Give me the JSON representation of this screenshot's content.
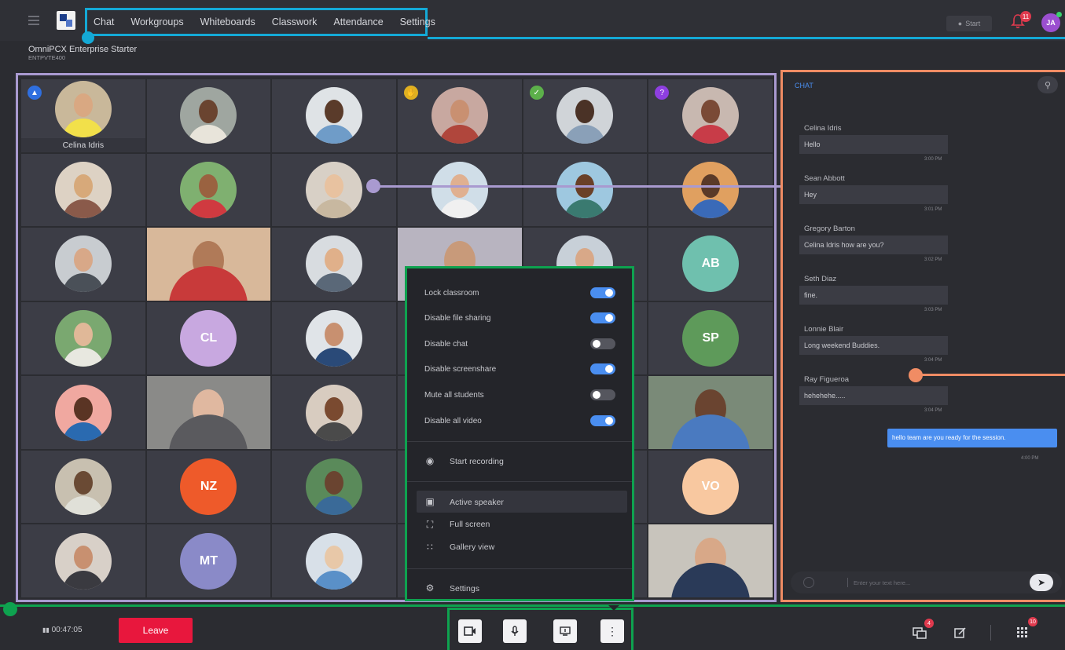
{
  "topbar": {
    "nav": [
      "Chat",
      "Workgroups",
      "Whiteboards",
      "Classwork",
      "Attendance",
      "Settings"
    ],
    "start_label": "Start",
    "notifications_count": "11",
    "user_initials": "JA"
  },
  "subheader": {
    "title": "OmniPCX Enterprise Starter",
    "code": "ENTPVTE400"
  },
  "gallery": {
    "first_participant_name": "Celina Idris",
    "initials": {
      "ab": "AB",
      "cl": "CL",
      "sp": "SP",
      "nz": "NZ",
      "vo": "VO",
      "mt": "MT"
    }
  },
  "settings_menu": {
    "toggles": [
      {
        "label": "Lock classroom",
        "on": true
      },
      {
        "label": "Disable file sharing",
        "on": true
      },
      {
        "label": "Disable chat",
        "on": false
      },
      {
        "label": "Disable screenshare",
        "on": true
      },
      {
        "label": "Mute all students",
        "on": false
      },
      {
        "label": "Disable all video",
        "on": true
      }
    ],
    "start_recording": "Start recording",
    "active_speaker": "Active speaker",
    "full_screen": "Full screen",
    "gallery_view": "Gallery view",
    "settings": "Settings"
  },
  "chat": {
    "title": "CHAT",
    "messages": [
      {
        "name": "Celina Idris",
        "text": "Hello",
        "time": "3:00 PM"
      },
      {
        "name": "Sean Abbott",
        "text": "Hey",
        "time": "3:01 PM"
      },
      {
        "name": "Gregory Barton",
        "text": "Celina Idris how are you?",
        "time": "3:02 PM"
      },
      {
        "name": "Seth Diaz",
        "text": "fine.",
        "time": "3:03 PM"
      },
      {
        "name": "Lonnie Blair",
        "text": "Long weekend Buddies.",
        "time": "3:04 PM"
      },
      {
        "name": "Ray Figueroa",
        "text": "hehehehe.....",
        "time": "3:04 PM"
      }
    ],
    "my_message": {
      "text": "hello team are you ready for the session.",
      "time": "4:00 PM"
    },
    "input_placeholder": "Enter your text here..."
  },
  "bottombar": {
    "timer": "00:47:05",
    "leave_label": "Leave",
    "chat_badge": "4",
    "apps_badge": "10"
  },
  "colors": {
    "annotation_blue": "#14a9d6",
    "annotation_purple": "#a99ad0",
    "annotation_orange": "#f08c64",
    "annotation_green": "#0ea24f",
    "leave_red": "#e8173d",
    "accent_blue": "#4a8ef0"
  }
}
